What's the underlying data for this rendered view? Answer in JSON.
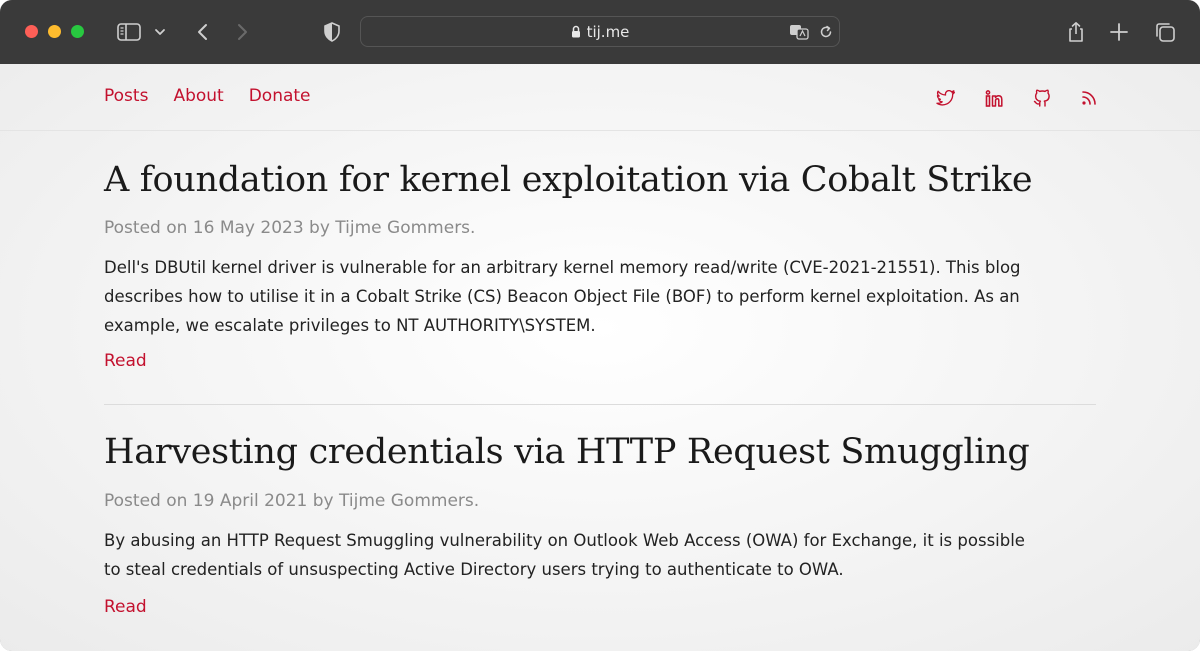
{
  "browser": {
    "url": "tij.me"
  },
  "nav": {
    "items": [
      {
        "label": "Posts"
      },
      {
        "label": "About"
      },
      {
        "label": "Donate"
      }
    ]
  },
  "social": [
    "twitter-icon",
    "linkedin-icon",
    "github-icon",
    "rss-icon"
  ],
  "colors": {
    "accent": "#c3112e",
    "toolbar": "#3a3a3a"
  },
  "posts": [
    {
      "title": "A foundation for kernel exploitation via Cobalt Strike",
      "meta": "Posted on 16 May 2023 by Tijme Gommers.",
      "desc_lines": [
        "Dell's DBUtil kernel driver is vulnerable for an arbitrary kernel memory read/write (CVE-2021-21551). This blog",
        "describes how to utilise it in a Cobalt Strike (CS) Beacon Object File (BOF) to perform kernel exploitation. As an",
        "example, we escalate privileges to NT AUTHORITY\\SYSTEM."
      ],
      "read": "Read"
    },
    {
      "title": "Harvesting credentials via HTTP Request Smuggling",
      "meta": "Posted on 19 April 2021 by Tijme Gommers.",
      "desc_lines": [
        "By abusing an HTTP Request Smuggling vulnerability on Outlook Web Access (OWA) for Exchange, it is possible",
        "to steal credentials of unsuspecting Active Directory users trying to authenticate to OWA."
      ],
      "read": "Read"
    }
  ]
}
